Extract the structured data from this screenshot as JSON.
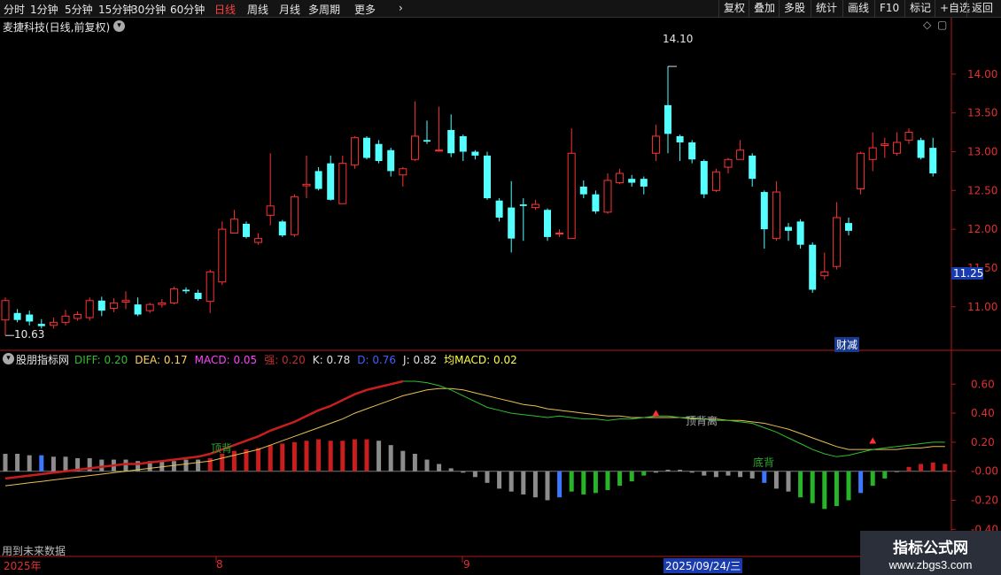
{
  "toolbar": {
    "periods": [
      "分时",
      "1分钟",
      "5分钟",
      "15分钟",
      "30分钟",
      "60分钟",
      "日线",
      "周线",
      "月线",
      "多周期",
      "更多"
    ],
    "active_period": "日线",
    "right_buttons": [
      "复权",
      "叠加",
      "多股",
      "统计",
      "画线",
      "F10",
      "标记",
      "+自选",
      "返回"
    ]
  },
  "header": {
    "stock_title": "麦捷科技(日线,前复权)"
  },
  "indicator_header": {
    "name": "股朋指标网",
    "items": [
      {
        "text": "DIFF: 0.20",
        "color": "#2fbf2f"
      },
      {
        "text": "DEA: 0.17",
        "color": "#ffd060"
      },
      {
        "text": "MACD: 0.05",
        "color": "#ff40ff"
      },
      {
        "text": "强: 0.20",
        "color": "#c03030"
      },
      {
        "text": "K: 0.78",
        "color": "#e0e0e0"
      },
      {
        "text": "D: 0.76",
        "color": "#4060ff"
      },
      {
        "text": "J: 0.82",
        "color": "#e0e0e0"
      },
      {
        "text": "均MACD: 0.02",
        "color": "#ffff40"
      }
    ]
  },
  "annotations": {
    "high_marker": "14.10",
    "low_marker": "10.63",
    "cai_jian": "财减",
    "divergence_top_1": "顶背离",
    "divergence_top_2": "顶背",
    "divergence_bottom": "底背",
    "future_data_note": "用到未来数据",
    "current_price": "11.25"
  },
  "colors": {
    "up": "#ff3232",
    "down": "#54ffff",
    "grid_axis": "#b01818",
    "macd_up": "#c81e1e",
    "macd_down": "#28b428",
    "macd_gray": "#8c8c8c",
    "macd_blue": "#3c78ff"
  },
  "bottom_axis": {
    "labels": [
      "2025年",
      "8",
      "9"
    ],
    "selected_date": "2025/09/24/三"
  },
  "watermark": {
    "line1": "指标公式网",
    "line2": "www.zbgs3.com"
  },
  "chart_data": {
    "type": "candlestick",
    "price_axis": {
      "ticks": [
        11.0,
        11.5,
        12.0,
        12.5,
        13.0,
        13.5,
        14.0
      ],
      "ylim": [
        10.45,
        14.5
      ]
    },
    "indicator_axis": {
      "ticks": [
        0.6,
        0.4,
        0.2,
        0.0,
        -0.2,
        -0.4
      ],
      "tick_labels": [
        "0.60",
        "0.40",
        "0.20",
        "-0.00",
        "-0.20",
        "-0.40"
      ],
      "ylim": [
        -0.52,
        0.76
      ]
    },
    "candles": [
      [
        10.83,
        11.08,
        10.63,
        11.12
      ],
      [
        10.92,
        10.83,
        10.8,
        10.97
      ],
      [
        10.9,
        10.81,
        10.76,
        10.95
      ],
      [
        10.78,
        10.75,
        10.72,
        10.84
      ],
      [
        10.76,
        10.8,
        10.72,
        10.86
      ],
      [
        10.8,
        10.88,
        10.76,
        10.96
      ],
      [
        10.85,
        10.9,
        10.82,
        10.94
      ],
      [
        10.86,
        11.08,
        10.82,
        11.12
      ],
      [
        11.08,
        10.95,
        10.88,
        11.13
      ],
      [
        10.98,
        11.05,
        10.93,
        11.11
      ],
      [
        11.06,
        11.08,
        10.97,
        11.2
      ],
      [
        11.03,
        10.9,
        10.88,
        11.12
      ],
      [
        10.95,
        11.03,
        10.92,
        11.05
      ],
      [
        11.03,
        11.05,
        10.99,
        11.1
      ],
      [
        11.05,
        11.23,
        11.03,
        11.26
      ],
      [
        11.22,
        11.2,
        11.17,
        11.25
      ],
      [
        11.18,
        11.1,
        11.08,
        11.22
      ],
      [
        11.07,
        11.45,
        10.92,
        11.48
      ],
      [
        11.32,
        12.0,
        11.28,
        12.1
      ],
      [
        11.95,
        12.13,
        11.95,
        12.25
      ],
      [
        12.07,
        11.9,
        11.88,
        12.1
      ],
      [
        11.83,
        11.88,
        11.8,
        11.95
      ],
      [
        12.18,
        12.3,
        12.05,
        12.98
      ],
      [
        12.1,
        11.92,
        11.9,
        12.12
      ],
      [
        11.93,
        12.42,
        11.9,
        12.45
      ],
      [
        12.56,
        12.58,
        12.4,
        12.95
      ],
      [
        12.75,
        12.52,
        12.5,
        12.8
      ],
      [
        12.85,
        12.38,
        12.37,
        12.95
      ],
      [
        12.33,
        12.85,
        12.33,
        12.95
      ],
      [
        12.83,
        13.18,
        12.78,
        13.2
      ],
      [
        13.18,
        12.92,
        12.9,
        13.2
      ],
      [
        13.1,
        12.88,
        12.85,
        13.15
      ],
      [
        13.02,
        12.75,
        12.68,
        13.05
      ],
      [
        12.7,
        12.78,
        12.55,
        12.8
      ],
      [
        12.9,
        13.2,
        12.88,
        13.65
      ],
      [
        13.15,
        13.13,
        13.1,
        13.4
      ],
      [
        13.02,
        13.02,
        13.0,
        13.58
      ],
      [
        13.28,
        12.98,
        12.93,
        13.48
      ],
      [
        13.2,
        13.0,
        12.88,
        13.22
      ],
      [
        13.0,
        12.95,
        12.9,
        13.02
      ],
      [
        12.95,
        12.4,
        12.38,
        13.0
      ],
      [
        12.37,
        12.15,
        12.1,
        12.4
      ],
      [
        12.28,
        11.88,
        11.7,
        12.62
      ],
      [
        12.32,
        12.3,
        11.85,
        12.4
      ],
      [
        12.28,
        12.32,
        12.25,
        12.38
      ],
      [
        12.25,
        11.9,
        11.85,
        12.27
      ],
      [
        11.95,
        11.95,
        11.9,
        12.0
      ],
      [
        11.88,
        12.98,
        11.88,
        13.3
      ],
      [
        12.55,
        12.45,
        12.4,
        12.63
      ],
      [
        12.45,
        12.23,
        12.2,
        12.5
      ],
      [
        12.22,
        12.63,
        12.2,
        12.72
      ],
      [
        12.6,
        12.72,
        12.58,
        12.78
      ],
      [
        12.65,
        12.6,
        12.55,
        12.7
      ],
      [
        12.65,
        12.55,
        12.45,
        12.68
      ],
      [
        12.98,
        13.2,
        12.88,
        13.35
      ],
      [
        13.6,
        13.23,
        12.98,
        14.1
      ],
      [
        13.2,
        13.12,
        12.88,
        13.22
      ],
      [
        13.12,
        12.9,
        12.85,
        13.15
      ],
      [
        12.88,
        12.45,
        12.4,
        12.9
      ],
      [
        12.5,
        12.74,
        12.48,
        12.78
      ],
      [
        12.8,
        12.9,
        12.72,
        12.92
      ],
      [
        12.9,
        13.02,
        12.9,
        13.15
      ],
      [
        12.95,
        12.65,
        12.55,
        12.98
      ],
      [
        12.48,
        12.0,
        11.75,
        12.5
      ],
      [
        11.88,
        12.48,
        11.85,
        12.62
      ],
      [
        12.03,
        11.98,
        11.85,
        12.08
      ],
      [
        12.1,
        11.8,
        11.75,
        12.13
      ],
      [
        11.8,
        11.22,
        11.18,
        11.83
      ],
      [
        11.4,
        11.45,
        11.35,
        11.7
      ],
      [
        11.52,
        12.15,
        11.48,
        12.35
      ],
      [
        12.08,
        11.98,
        11.92,
        12.15
      ],
      [
        12.52,
        12.98,
        12.45,
        13.0
      ],
      [
        12.9,
        13.05,
        12.75,
        13.25
      ],
      [
        13.08,
        13.1,
        12.92,
        13.18
      ],
      [
        12.98,
        13.12,
        12.95,
        13.25
      ],
      [
        13.15,
        13.25,
        13.1,
        13.3
      ],
      [
        13.15,
        12.92,
        12.9,
        13.18
      ],
      [
        13.05,
        12.72,
        12.68,
        13.18
      ]
    ],
    "macd_hist": [
      0.12,
      0.12,
      0.11,
      0.11,
      0.1,
      0.1,
      0.09,
      0.09,
      0.08,
      0.08,
      0.08,
      0.07,
      0.07,
      0.07,
      0.07,
      0.08,
      0.08,
      0.09,
      0.12,
      0.14,
      0.15,
      0.16,
      0.18,
      0.19,
      0.2,
      0.21,
      0.22,
      0.21,
      0.21,
      0.22,
      0.22,
      0.21,
      0.18,
      0.14,
      0.12,
      0.08,
      0.05,
      0.02,
      -0.01,
      -0.04,
      -0.08,
      -0.12,
      -0.14,
      -0.16,
      -0.18,
      -0.2,
      -0.18,
      -0.14,
      -0.16,
      -0.15,
      -0.13,
      -0.1,
      -0.07,
      -0.03,
      -0.01,
      0.01,
      0.01,
      -0.01,
      -0.03,
      -0.04,
      -0.03,
      -0.04,
      -0.05,
      -0.08,
      -0.12,
      -0.14,
      -0.18,
      -0.22,
      -0.26,
      -0.24,
      -0.2,
      -0.15,
      -0.1,
      -0.05,
      0.0,
      0.03,
      0.05,
      0.06,
      0.05
    ],
    "diff": [
      -0.05,
      -0.04,
      -0.03,
      -0.02,
      -0.01,
      0.0,
      0.01,
      0.02,
      0.03,
      0.04,
      0.05,
      0.05,
      0.06,
      0.07,
      0.08,
      0.09,
      0.1,
      0.12,
      0.15,
      0.18,
      0.21,
      0.24,
      0.28,
      0.31,
      0.34,
      0.38,
      0.42,
      0.45,
      0.49,
      0.53,
      0.56,
      0.58,
      0.6,
      0.62,
      0.62,
      0.61,
      0.59,
      0.56,
      0.52,
      0.48,
      0.44,
      0.42,
      0.4,
      0.39,
      0.38,
      0.37,
      0.38,
      0.37,
      0.36,
      0.36,
      0.35,
      0.36,
      0.36,
      0.37,
      0.38,
      0.38,
      0.37,
      0.37,
      0.36,
      0.35,
      0.35,
      0.34,
      0.33,
      0.3,
      0.27,
      0.23,
      0.19,
      0.15,
      0.12,
      0.1,
      0.11,
      0.13,
      0.15,
      0.16,
      0.17,
      0.18,
      0.19,
      0.2,
      0.2
    ],
    "dea": [
      -0.1,
      -0.09,
      -0.08,
      -0.07,
      -0.06,
      -0.05,
      -0.04,
      -0.03,
      -0.02,
      -0.01,
      0.0,
      0.01,
      0.02,
      0.03,
      0.04,
      0.05,
      0.06,
      0.07,
      0.09,
      0.11,
      0.13,
      0.15,
      0.18,
      0.21,
      0.24,
      0.27,
      0.3,
      0.33,
      0.36,
      0.4,
      0.43,
      0.46,
      0.49,
      0.52,
      0.54,
      0.56,
      0.57,
      0.57,
      0.56,
      0.54,
      0.52,
      0.5,
      0.48,
      0.46,
      0.45,
      0.43,
      0.42,
      0.41,
      0.4,
      0.39,
      0.38,
      0.38,
      0.37,
      0.37,
      0.37,
      0.37,
      0.37,
      0.36,
      0.36,
      0.36,
      0.35,
      0.35,
      0.34,
      0.33,
      0.31,
      0.29,
      0.26,
      0.23,
      0.2,
      0.17,
      0.15,
      0.15,
      0.15,
      0.15,
      0.15,
      0.16,
      0.16,
      0.17,
      0.17
    ]
  }
}
